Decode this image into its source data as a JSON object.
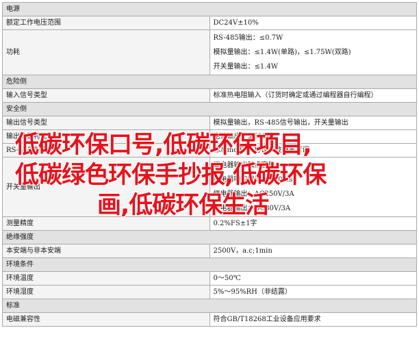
{
  "rows": [
    {
      "type": "section",
      "label": "电源"
    },
    {
      "type": "item",
      "key": "额定工作电压范围",
      "values": [
        "DC24V±10%"
      ]
    },
    {
      "type": "item",
      "key": "功耗",
      "values": [
        "RS-485输出：≤0.7W",
        "模拟量输出：≤1.4W(单路)，≤1.75W(双路)",
        "开关量输出：≤1.4W"
      ]
    },
    {
      "type": "section",
      "label": "危险侧"
    },
    {
      "type": "item",
      "key": "输入信号类型",
      "values": [
        "标准热电阻输入（订货时确定或通过编程器自行编程）"
      ]
    },
    {
      "type": "section",
      "label": "安全侧"
    },
    {
      "type": "item",
      "key": "输出信号类型",
      "values": [
        "模拟量输出，RS-485信号输出，开关量输出"
      ]
    },
    {
      "type": "item",
      "key": "输出负载特性",
      "values": [
        "电流输出：≤500Ω"
      ]
    },
    {
      "type": "item",
      "key": "RS-485信号输出",
      "values": [
        "标准modbus协议，波特率可调"
      ]
    },
    {
      "type": "item",
      "key": "开关量输出",
      "values": [
        "继电器输出触点容量",
        "继电器响应时间：≤10ms",
        "继电器输出：AC250V/3A",
        "继电器输出：DC30V/3A"
      ]
    },
    {
      "type": "item",
      "key": "测量精度",
      "values": [
        "0.2%FS±1字"
      ]
    },
    {
      "type": "section",
      "label": "绝缘强度"
    },
    {
      "type": "item",
      "key": "本安端与非本安端",
      "values": [
        "2500V，a.c;1min"
      ]
    },
    {
      "type": "section",
      "label": "环境条件"
    },
    {
      "type": "item",
      "key": "环境温度",
      "values": [
        "0～50℃"
      ]
    },
    {
      "type": "item",
      "key": "环境湿度",
      "values": [
        "5%～95%RH（非结露）"
      ]
    },
    {
      "type": "section",
      "label": "标准"
    },
    {
      "type": "item",
      "key": "电磁兼容性",
      "values": [
        "符合GB/T18268工业设备应用要求"
      ]
    }
  ],
  "overlay": {
    "line1": "低碳环保口号,低碳环保项目,",
    "line2": "低碳绿色环保手抄报,低碳环保",
    "line3": "画,低碳环保生活"
  }
}
